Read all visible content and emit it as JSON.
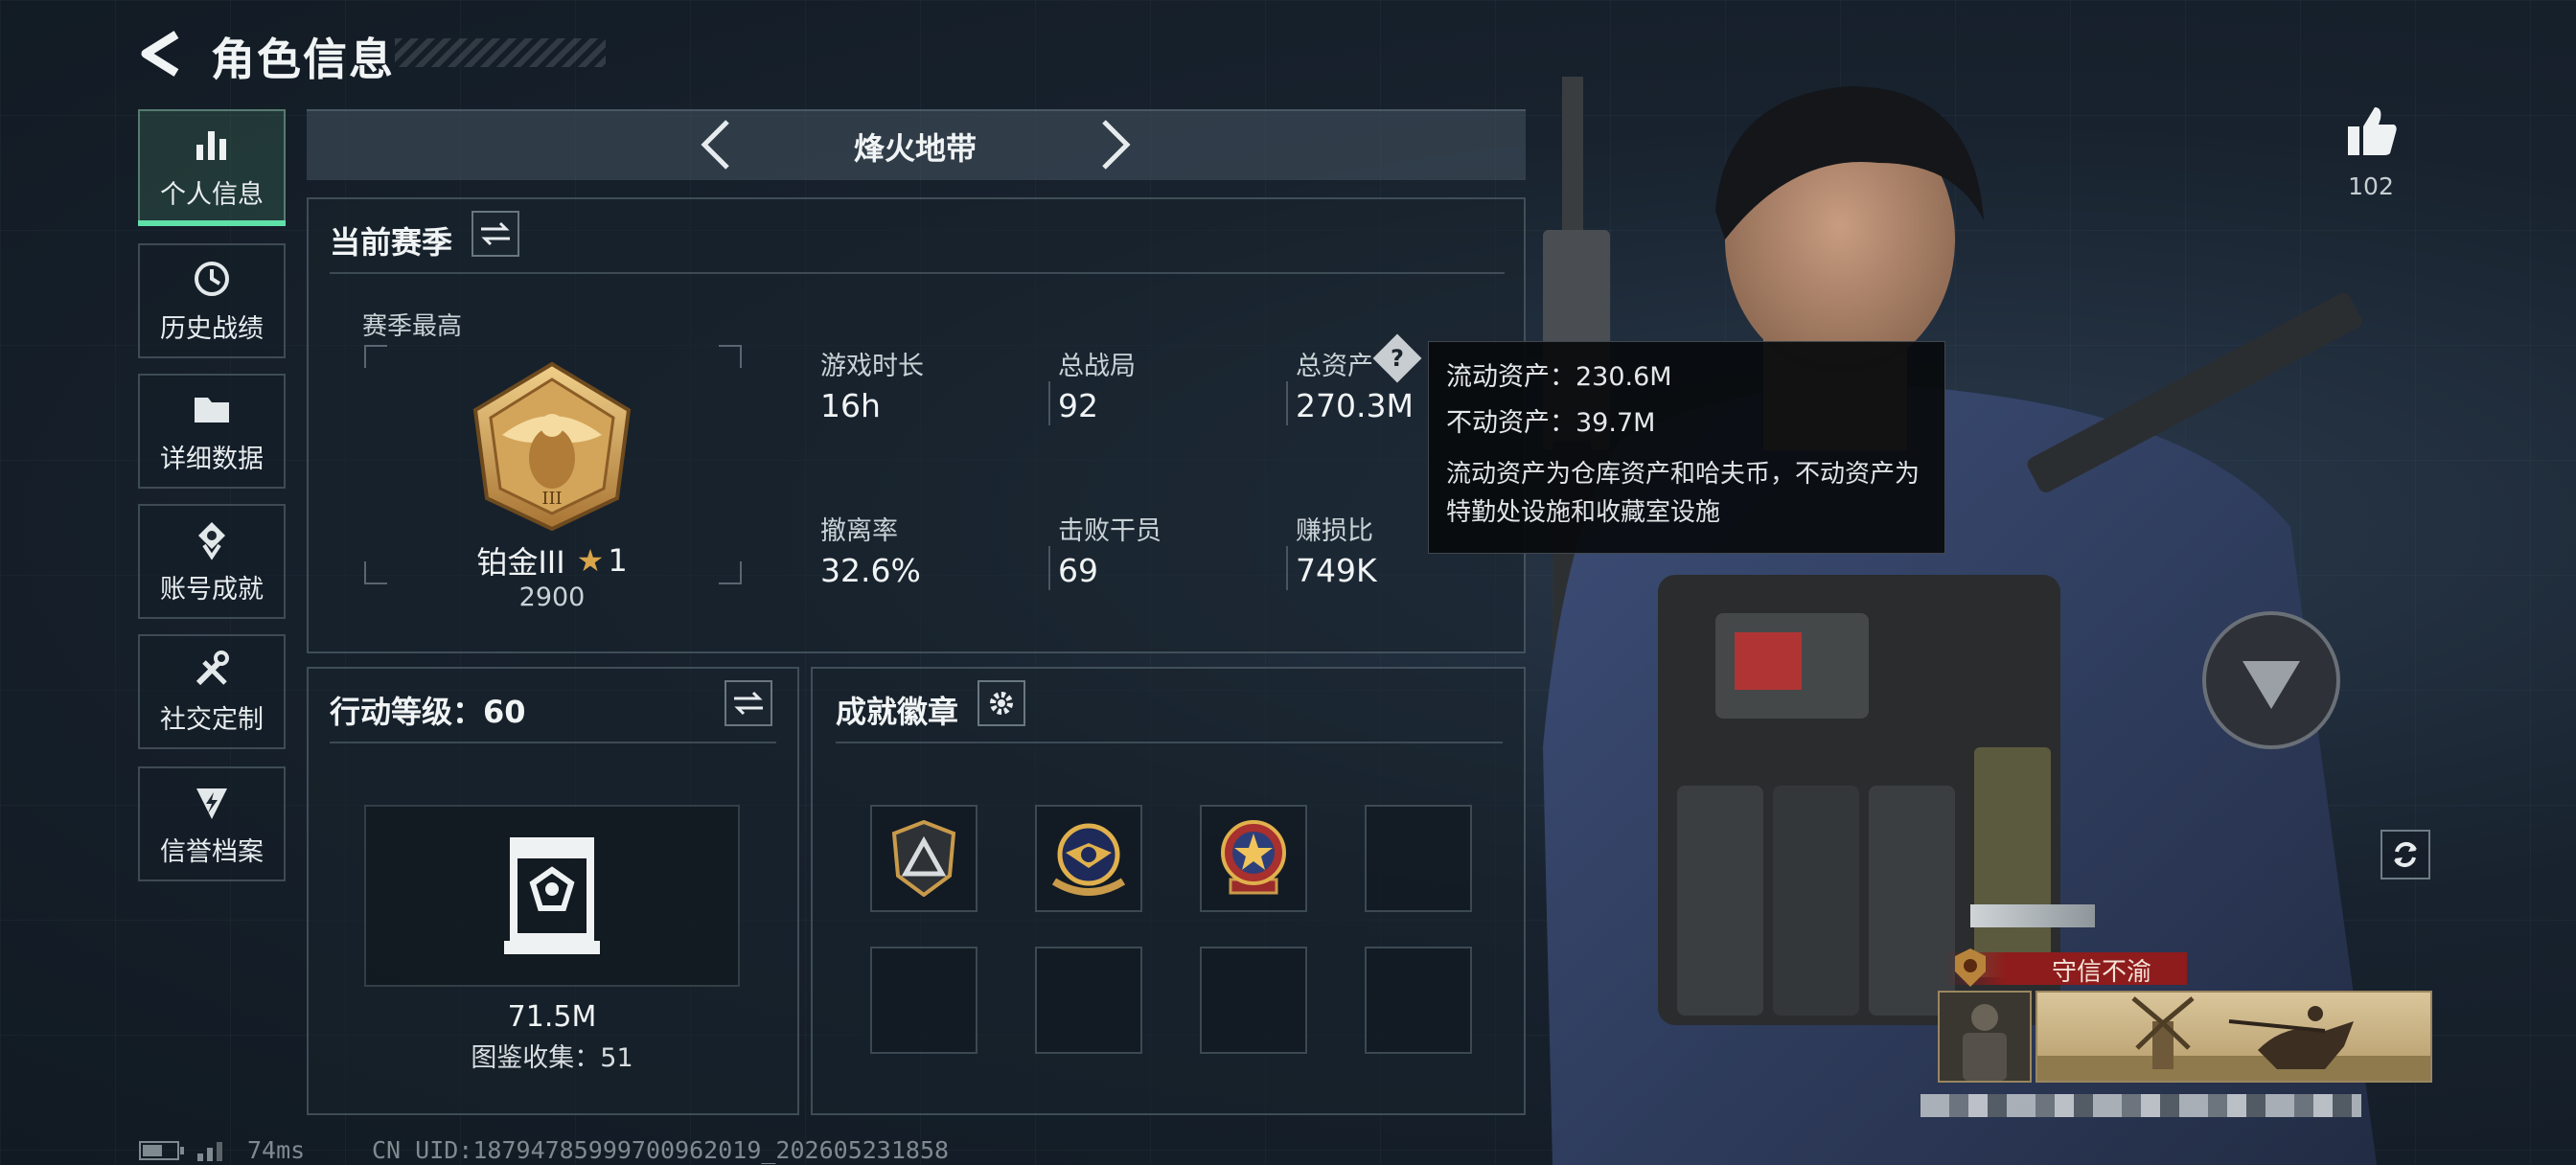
{
  "header": {
    "title": "角色信息"
  },
  "sidebar": {
    "items": [
      {
        "label": "个人信息",
        "icon": "bar-chart-icon",
        "active": true
      },
      {
        "label": "历史战绩",
        "icon": "history-clock-icon",
        "active": false
      },
      {
        "label": "详细数据",
        "icon": "folder-icon",
        "active": false
      },
      {
        "label": "账号成就",
        "icon": "achievement-icon",
        "active": false
      },
      {
        "label": "社交定制",
        "icon": "wrench-screwdriver-icon",
        "active": false
      },
      {
        "label": "信誉档案",
        "icon": "shield-bolt-icon",
        "active": false
      }
    ]
  },
  "mode": {
    "label": "烽火地带"
  },
  "season": {
    "title": "当前赛季",
    "peak_label": "赛季最高",
    "rank_name": "铂金III",
    "rank_stars": "1",
    "rank_score": "2900",
    "stats": [
      {
        "label": "游戏时长",
        "value": "16h"
      },
      {
        "label": "总战局",
        "value": "92"
      },
      {
        "label": "总资产",
        "value": "270.3M"
      },
      {
        "label": "撤离率",
        "value": "32.6%"
      },
      {
        "label": "击败干员",
        "value": "69"
      },
      {
        "label": "赚损比",
        "value": "749K"
      }
    ]
  },
  "tooltip": {
    "liquid": "流动资产：230.6M",
    "fixed": "不动资产：39.7M",
    "desc": "流动资产为仓库资产和哈夫币，不动资产为特勤处设施和收藏室设施"
  },
  "action_level": {
    "title": "行动等级：60",
    "value": "71.5M",
    "collection": "图鉴收集：51"
  },
  "achievements": {
    "title": "成就徽章",
    "slots": [
      "triangle-badge",
      "eagle-crest-badge",
      "star-medal-badge",
      "empty",
      "empty",
      "empty",
      "empty",
      "empty"
    ]
  },
  "likes": {
    "count": "102"
  },
  "player_card": {
    "tag": "守信不渝"
  },
  "footer": {
    "ping": "74ms",
    "uid": "CN UID:18794785999700962019_202605231858"
  },
  "colors": {
    "accent": "#5fe0a7",
    "gold": "#d9a54a",
    "tag_red": "#8e1c1c"
  }
}
